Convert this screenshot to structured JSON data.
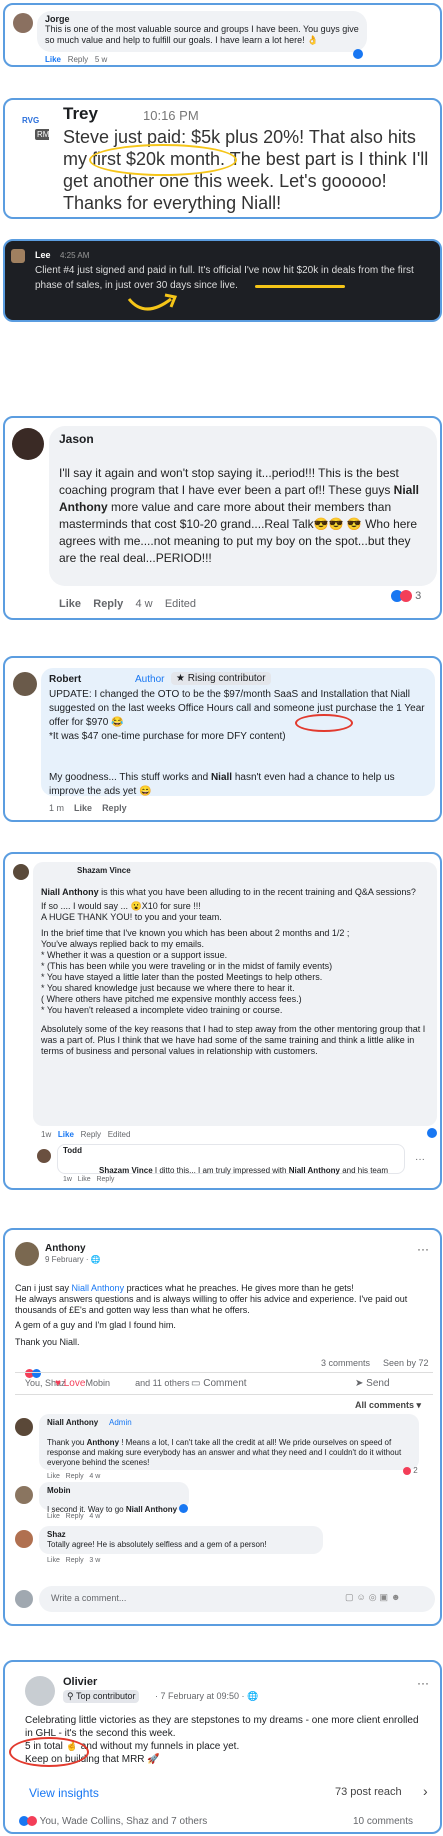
{
  "jorge": {
    "name": "Jorge",
    "text": "This is one of the most valuable source and groups I have been. You guys give so much value and help to fulfill our goals. I have learn a lot here! 👌",
    "like": "Like",
    "reply": "Reply",
    "time": "5 w"
  },
  "trey": {
    "logo_top": "RVG",
    "logo_bottom": "RM",
    "name": "Trey",
    "time": "10:16 PM",
    "text": "Steve just paid: $5k plus 20%! That also hits my first $20k month. The best part is I think I'll get another one this week. Let's gooooo! Thanks for everything Niall!"
  },
  "lee": {
    "name": "Lee",
    "time": "4:25 AM",
    "text": "Client #4 just signed and paid in full. It's official I've now hit $20k in deals from the first phase of sales, in just over 30 days since live."
  },
  "jason": {
    "name": "Jason",
    "text_a": "I'll say it again and won't stop saying it...period!!! This is the best coaching program that I have ever been a part of!! These guys ",
    "bold": "Niall Anthony",
    "text_b": " more value and care more about their members than masterminds that cost $10-20 grand....Real Talk😎😎 😎 Who here agrees with me....not meaning to put my boy  on the spot...but they are the real deal...PERIOD!!!",
    "like": "Like",
    "reply": "Reply",
    "time": "4 w",
    "edited": "Edited",
    "reactions": "3"
  },
  "robert": {
    "name": "Robert",
    "badge1": "Author",
    "badge2": "Rising contributor",
    "text1": "UPDATE: I changed the OTO to be the $97/month SaaS and Installation that Niall suggested on the last weeks Office Hours call and someone just purchase the 1 Year offer for $970 😂\n*It was $47 one-time purchase for more DFY content)",
    "text2_a": "My goodness... This stuff works and ",
    "text2_bold": "Niall",
    "text2_b": " hasn't even had a chance to help us improve the ads yet 😄",
    "time": "1 m",
    "like": "Like",
    "reply": "Reply"
  },
  "shazam": {
    "name": "Shazam Vince",
    "p1_bold": "Niall Anthony",
    "p1": " is this what you have been alluding to in the recent training and Q&A sessions?",
    "p2": "If so .... I would say ... 😮X10 for sure !!!\nA HUGE THANK YOU! to you and your team.",
    "p3": "In the brief time that I've known you which has been about 2 months and 1/2 ;\nYou've always replied back to my emails.\n* Whether it was a question or a support issue.\n* (This has been while you were traveling or in the midst of family events)\n* You have stayed a little later than the posted Meetings to help others.\n* You shared knowledge just because we where there to hear it.\n( Where others have pitched me expensive monthly access fees.)\n* You haven't released a incomplete video training or course.",
    "p4": "Absolutely some of the key reasons that I had to step away from the other mentoring group that I was a part of. Plus I think that we have had some of the same training and think a little alike in terms of business and personal values in relationship with customers.",
    "time": "1w",
    "like": "Like",
    "reply": "Reply",
    "edited": "Edited",
    "reply_name": "Todd",
    "reply_tag": "Shazam Vince",
    "reply_text": " I ditto this... I am truly impressed with ",
    "reply_bold": "Niall Anthony",
    "reply_text2": " and his team",
    "reply_time": "1w",
    "reply_like": "Like",
    "reply_reply": "Reply"
  },
  "anthony": {
    "name": "Anthony",
    "date": "9 February · 🌐",
    "text_a": "Can i just say ",
    "link": "Niall Anthony",
    "text_b": " practices what he preaches. He gives more than he gets!\nHe always answers questions and is always willing to offer his advice and experience. I've paid out thousands of £E's and gotten way less than  what he offers.",
    "text_c": "A gem of a guy and I'm glad I found him.",
    "text_d": "Thank you Niall.",
    "reactors": "You, Shaz        Mobin          and 11 others",
    "comments": "3 comments",
    "seen": "Seen by 72",
    "love": "Love",
    "comment": "Comment",
    "send": "Send",
    "all_comments": "All comments ▾",
    "c1_name": "Niall Anthony",
    "c1_badge": "Admin",
    "c1_text_a": "Thank you ",
    "c1_bold": "Anthony",
    "c1_text_b": "          ! Means a lot, I can't take all the credit at all! We pride ourselves on speed of response and making sure everybody has an answer and what they need and I couldn't do it without everyone behind the scenes!",
    "c1_time": "Like   Reply   4 w",
    "c1_react": "2",
    "c2_name": "Mobin",
    "c2_text_a": "I second it. Way to go ",
    "c2_bold": "Niall Anthony",
    "c2_time": "Like   Reply   4 w",
    "c3_name": "Shaz",
    "c3_text": "Totally agree! He is absolutely selfless and a gem of a person!",
    "c3_time": "Like   Reply   3 w",
    "write": "Write a comment..."
  },
  "olivier": {
    "name": "Olivier",
    "badge": "Top contributor",
    "date": "· 7 February at 09:50 · 🌐",
    "text": "Celebrating little victories as they are stepstones to my dreams - one more client enrolled in GHL - it's the second this week.\n5 in total 🤞 and without my funnels in place yet.\nKeep on building that MRR 🚀",
    "insights": "View insights",
    "reach": "73 post reach",
    "reactors": "You, Wade Collins, Shaz and 7 others",
    "comments": "10 comments"
  }
}
